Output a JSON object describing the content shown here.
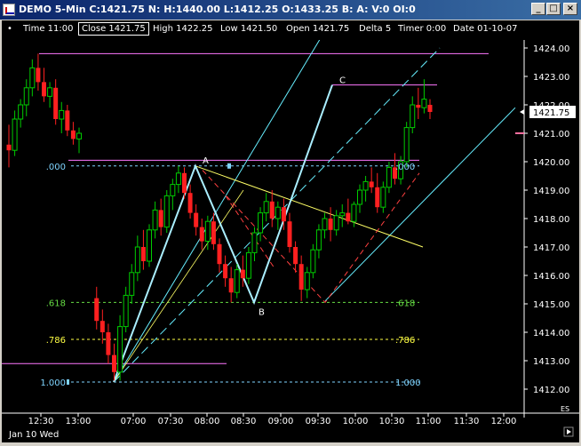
{
  "window": {
    "title": "DEMO 5-Min C:1421.75 N: H:1440.00 L:1412.25 O:1433.25 B: A: V:0 OI:0",
    "buttons": [
      "_",
      "□",
      "×"
    ]
  },
  "infobar": {
    "time": "Time 11:00",
    "close": "Close 1421.75",
    "high": "High 1422.25",
    "low": "Low 1421.50",
    "open": "Open 1421.75",
    "delta": "Delta 5",
    "timer": "Timer 0:00",
    "date": "Date 01-10-07"
  },
  "colors": {
    "background": "#000000",
    "bull_candle": "#00cc00",
    "bear_candle": "#ff2020",
    "fib_level": "#7fd4ff",
    "fib_618": "#66dd44",
    "fib_786": "#ffff44",
    "magenta_line": "#ff77ff",
    "pattern_line": "#66eeff",
    "trend_line": "#ffff66"
  },
  "chart_data": {
    "type": "candlestick",
    "symbol": "ES",
    "price_badge": "1421.75",
    "session_label": "Jan 10 Wed",
    "ylim": [
      1411.8,
      1424.4
    ],
    "y_ticks": [
      "1424.00",
      "1423.00",
      "1422.00",
      "1421.00",
      "1420.00",
      "1419.00",
      "1418.00",
      "1417.00",
      "1416.00",
      "1415.00",
      "1414.00",
      "1413.00",
      "1412.00"
    ],
    "x_ticks": [
      "12:30",
      "13:00",
      "07:00",
      "07:30",
      "08:00",
      "08:30",
      "09:00",
      "09:30",
      "10:00",
      "10:30",
      "11:00",
      "11:30",
      "12:00"
    ],
    "fib_levels": [
      {
        "label": ".000",
        "right_label": ".000",
        "price": 1419.85
      },
      {
        "label": ".618",
        "right_label": ".618",
        "price": 1415.05
      },
      {
        "label": ".786",
        "right_label": ".786",
        "price": 1413.75
      },
      {
        "label": "1.000",
        "right_label": "1.000",
        "price": 1412.25
      }
    ],
    "pattern_points": [
      {
        "label": "A",
        "price": 1419.85
      },
      {
        "label": "B",
        "price": 1415.05
      },
      {
        "label": "C",
        "price": 1422.7
      }
    ],
    "candles": [
      {
        "o": 1420.6,
        "h": 1421.3,
        "l": 1419.8,
        "c": 1420.4
      },
      {
        "o": 1420.4,
        "h": 1421.8,
        "l": 1420.2,
        "c": 1421.5
      },
      {
        "o": 1421.5,
        "h": 1422.2,
        "l": 1421.2,
        "c": 1422.0
      },
      {
        "o": 1422.0,
        "h": 1422.9,
        "l": 1421.6,
        "c": 1422.6
      },
      {
        "o": 1422.6,
        "h": 1423.6,
        "l": 1422.3,
        "c": 1423.3
      },
      {
        "o": 1423.3,
        "h": 1423.8,
        "l": 1422.5,
        "c": 1422.8
      },
      {
        "o": 1422.8,
        "h": 1423.3,
        "l": 1422.1,
        "c": 1422.3
      },
      {
        "o": 1422.3,
        "h": 1422.8,
        "l": 1421.9,
        "c": 1422.6
      },
      {
        "o": 1422.6,
        "h": 1422.9,
        "l": 1421.3,
        "c": 1421.5
      },
      {
        "o": 1421.5,
        "h": 1422.1,
        "l": 1421.0,
        "c": 1421.8
      },
      {
        "o": 1421.8,
        "h": 1422.0,
        "l": 1420.9,
        "c": 1421.1
      },
      {
        "o": 1421.1,
        "h": 1421.4,
        "l": 1420.6,
        "c": 1420.8
      },
      {
        "o": 1420.8,
        "h": 1421.2,
        "l": 1420.3,
        "c": 1421.0
      },
      {
        "o": 1415.2,
        "h": 1415.6,
        "l": 1414.1,
        "c": 1414.4
      },
      {
        "o": 1414.4,
        "h": 1414.8,
        "l": 1413.6,
        "c": 1414.0
      },
      {
        "o": 1414.0,
        "h": 1414.3,
        "l": 1412.9,
        "c": 1413.2
      },
      {
        "o": 1413.2,
        "h": 1413.6,
        "l": 1412.3,
        "c": 1412.6
      },
      {
        "o": 1412.6,
        "h": 1414.6,
        "l": 1412.3,
        "c": 1414.2
      },
      {
        "o": 1414.2,
        "h": 1415.6,
        "l": 1414.0,
        "c": 1415.3
      },
      {
        "o": 1415.3,
        "h": 1416.4,
        "l": 1415.0,
        "c": 1416.1
      },
      {
        "o": 1416.1,
        "h": 1417.4,
        "l": 1415.8,
        "c": 1417.0
      },
      {
        "o": 1417.0,
        "h": 1417.6,
        "l": 1416.2,
        "c": 1416.5
      },
      {
        "o": 1416.5,
        "h": 1417.8,
        "l": 1416.3,
        "c": 1417.6
      },
      {
        "o": 1417.6,
        "h": 1418.6,
        "l": 1417.3,
        "c": 1418.3
      },
      {
        "o": 1418.3,
        "h": 1418.7,
        "l": 1417.4,
        "c": 1417.7
      },
      {
        "o": 1417.7,
        "h": 1419.0,
        "l": 1417.5,
        "c": 1418.8
      },
      {
        "o": 1418.8,
        "h": 1419.4,
        "l": 1418.3,
        "c": 1419.2
      },
      {
        "o": 1419.2,
        "h": 1419.85,
        "l": 1418.9,
        "c": 1419.6
      },
      {
        "o": 1419.6,
        "h": 1419.8,
        "l": 1418.7,
        "c": 1418.9
      },
      {
        "o": 1418.9,
        "h": 1419.2,
        "l": 1418.0,
        "c": 1418.2
      },
      {
        "o": 1418.2,
        "h": 1418.5,
        "l": 1417.4,
        "c": 1417.7
      },
      {
        "o": 1417.7,
        "h": 1418.0,
        "l": 1416.9,
        "c": 1417.2
      },
      {
        "o": 1417.2,
        "h": 1418.1,
        "l": 1416.9,
        "c": 1417.9
      },
      {
        "o": 1417.9,
        "h": 1418.2,
        "l": 1416.9,
        "c": 1417.1
      },
      {
        "o": 1417.1,
        "h": 1417.3,
        "l": 1416.1,
        "c": 1416.4
      },
      {
        "o": 1416.4,
        "h": 1416.7,
        "l": 1415.6,
        "c": 1415.9
      },
      {
        "o": 1415.9,
        "h": 1416.3,
        "l": 1415.05,
        "c": 1415.4
      },
      {
        "o": 1415.4,
        "h": 1416.4,
        "l": 1415.2,
        "c": 1416.2
      },
      {
        "o": 1416.2,
        "h": 1416.7,
        "l": 1415.6,
        "c": 1415.9
      },
      {
        "o": 1415.9,
        "h": 1417.0,
        "l": 1415.7,
        "c": 1416.8
      },
      {
        "o": 1416.8,
        "h": 1417.7,
        "l": 1416.5,
        "c": 1417.5
      },
      {
        "o": 1417.5,
        "h": 1418.4,
        "l": 1417.2,
        "c": 1418.2
      },
      {
        "o": 1418.2,
        "h": 1418.9,
        "l": 1417.9,
        "c": 1418.6
      },
      {
        "o": 1418.6,
        "h": 1419.0,
        "l": 1417.7,
        "c": 1418.0
      },
      {
        "o": 1418.0,
        "h": 1418.6,
        "l": 1417.6,
        "c": 1418.4
      },
      {
        "o": 1418.4,
        "h": 1418.7,
        "l": 1417.6,
        "c": 1417.9
      },
      {
        "o": 1417.9,
        "h": 1418.2,
        "l": 1416.8,
        "c": 1417.0
      },
      {
        "o": 1417.0,
        "h": 1417.2,
        "l": 1416.1,
        "c": 1416.4
      },
      {
        "o": 1416.4,
        "h": 1416.7,
        "l": 1415.1,
        "c": 1415.5
      },
      {
        "o": 1415.5,
        "h": 1416.3,
        "l": 1415.2,
        "c": 1416.1
      },
      {
        "o": 1416.1,
        "h": 1417.1,
        "l": 1415.9,
        "c": 1416.9
      },
      {
        "o": 1416.9,
        "h": 1417.8,
        "l": 1416.6,
        "c": 1417.6
      },
      {
        "o": 1417.6,
        "h": 1418.2,
        "l": 1417.3,
        "c": 1418.0
      },
      {
        "o": 1418.0,
        "h": 1418.4,
        "l": 1417.2,
        "c": 1417.6
      },
      {
        "o": 1417.6,
        "h": 1418.3,
        "l": 1417.4,
        "c": 1418.1
      },
      {
        "o": 1418.1,
        "h": 1418.5,
        "l": 1417.7,
        "c": 1418.2
      },
      {
        "o": 1418.2,
        "h": 1418.7,
        "l": 1417.8,
        "c": 1417.9
      },
      {
        "o": 1417.9,
        "h": 1418.6,
        "l": 1417.7,
        "c": 1418.5
      },
      {
        "o": 1418.5,
        "h": 1419.2,
        "l": 1418.2,
        "c": 1419.0
      },
      {
        "o": 1419.0,
        "h": 1419.5,
        "l": 1418.6,
        "c": 1419.3
      },
      {
        "o": 1419.3,
        "h": 1419.8,
        "l": 1418.9,
        "c": 1419.1
      },
      {
        "o": 1419.1,
        "h": 1419.6,
        "l": 1418.2,
        "c": 1418.4
      },
      {
        "o": 1418.4,
        "h": 1419.3,
        "l": 1418.2,
        "c": 1419.1
      },
      {
        "o": 1419.1,
        "h": 1420.0,
        "l": 1418.9,
        "c": 1419.8
      },
      {
        "o": 1419.8,
        "h": 1420.3,
        "l": 1419.2,
        "c": 1419.4
      },
      {
        "o": 1419.4,
        "h": 1420.2,
        "l": 1419.2,
        "c": 1420.0
      },
      {
        "o": 1420.0,
        "h": 1421.4,
        "l": 1419.8,
        "c": 1421.2
      },
      {
        "o": 1421.2,
        "h": 1422.3,
        "l": 1421.0,
        "c": 1422.0
      },
      {
        "o": 1422.0,
        "h": 1422.6,
        "l": 1421.5,
        "c": 1421.9
      },
      {
        "o": 1421.9,
        "h": 1422.9,
        "l": 1421.7,
        "c": 1422.2
      },
      {
        "o": 1422.0,
        "h": 1422.2,
        "l": 1421.5,
        "c": 1421.75
      }
    ]
  }
}
